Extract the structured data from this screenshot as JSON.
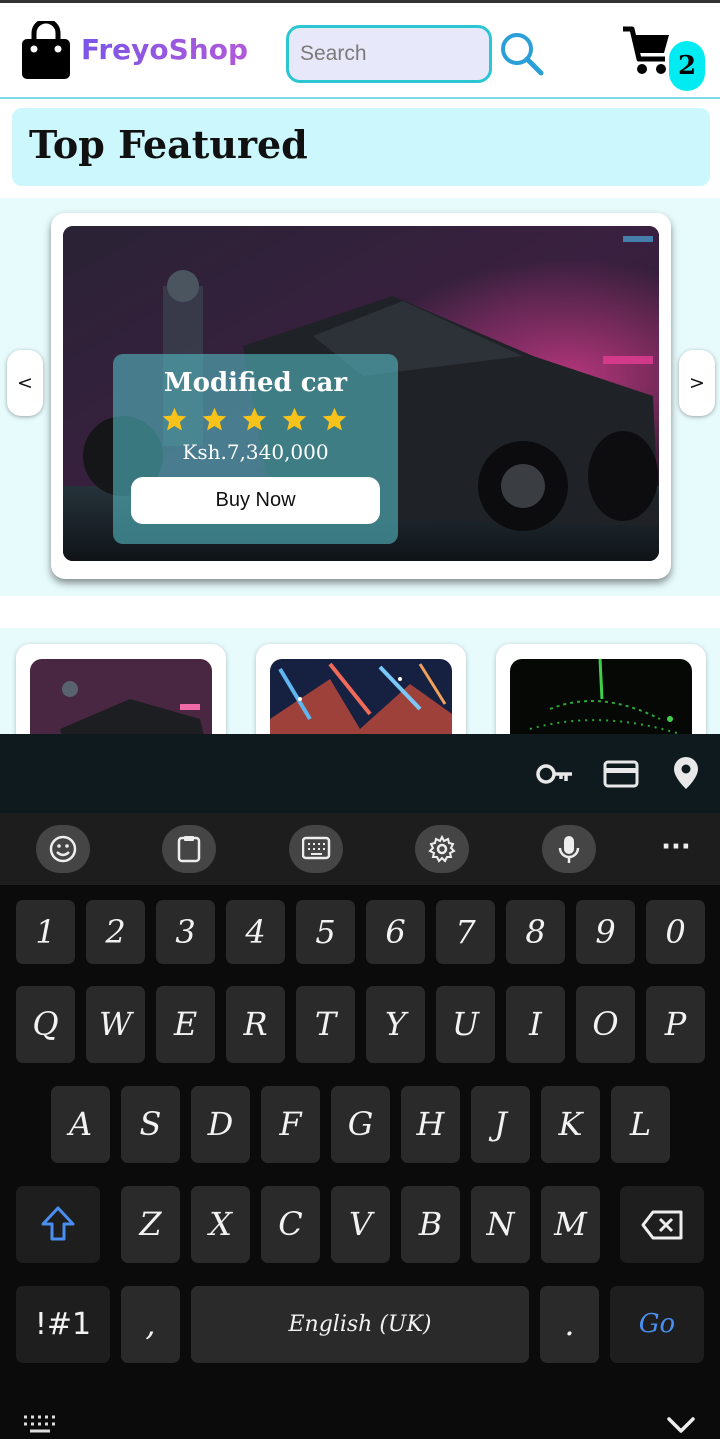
{
  "header": {
    "brand": "FreyoShop",
    "search_placeholder": "Search",
    "cart_count": "2"
  },
  "featured": {
    "title": "Top Featured"
  },
  "carousel": {
    "prev_label": "<",
    "next_label": ">",
    "item": {
      "name": "Modified car",
      "rating": 5,
      "price": "Ksh.7,340,000",
      "buy_label": "Buy Now"
    }
  },
  "keyboard": {
    "autofill_icons": [
      "key-icon",
      "card-icon",
      "location-icon"
    ],
    "toolbar_icons": [
      "emoji-icon",
      "clipboard-icon",
      "keyboard-icon",
      "settings-icon",
      "microphone-icon",
      "more-icon"
    ],
    "more_label": "···",
    "rows": [
      [
        "1",
        "2",
        "3",
        "4",
        "5",
        "6",
        "7",
        "8",
        "9",
        "0"
      ],
      [
        "Q",
        "W",
        "E",
        "R",
        "T",
        "Y",
        "U",
        "I",
        "O",
        "P"
      ],
      [
        "A",
        "S",
        "D",
        "F",
        "G",
        "H",
        "J",
        "K",
        "L"
      ],
      [
        "Z",
        "X",
        "C",
        "V",
        "B",
        "N",
        "M"
      ]
    ],
    "symbols_label": "!#1",
    "comma_label": ",",
    "space_label": "English (UK)",
    "period_label": ".",
    "go_label": "Go",
    "accent_color": "#4a8ff0"
  }
}
